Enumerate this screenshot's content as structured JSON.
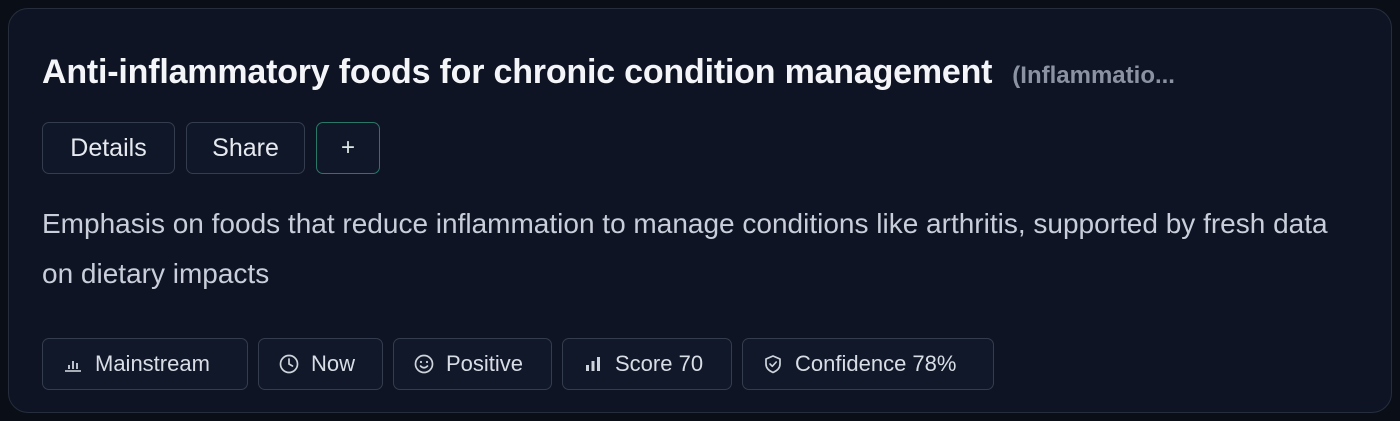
{
  "card": {
    "title": "Anti-inflammatory foods for chronic condition management",
    "category": "(Inflammatio...",
    "actions": {
      "details_label": "Details",
      "share_label": "Share",
      "add_label": "+"
    },
    "description": "Emphasis on foods that reduce inflammation to manage conditions like arthritis, supported by fresh data on dietary impacts",
    "chips": [
      {
        "label": "Mainstream",
        "icon": "bar-chart-icon"
      },
      {
        "label": "Now",
        "icon": "clock-icon"
      },
      {
        "label": "Positive",
        "icon": "smile-icon"
      },
      {
        "label": "Score 70",
        "icon": "signal-bars-icon"
      },
      {
        "label": "Confidence 78%",
        "icon": "shield-icon"
      }
    ]
  },
  "colors": {
    "background": "#0a0e17",
    "card_background": "#0e1424",
    "accent_border": "#2a7768",
    "title_text": "#f3f5f8",
    "muted_text": "#8b93a3"
  }
}
